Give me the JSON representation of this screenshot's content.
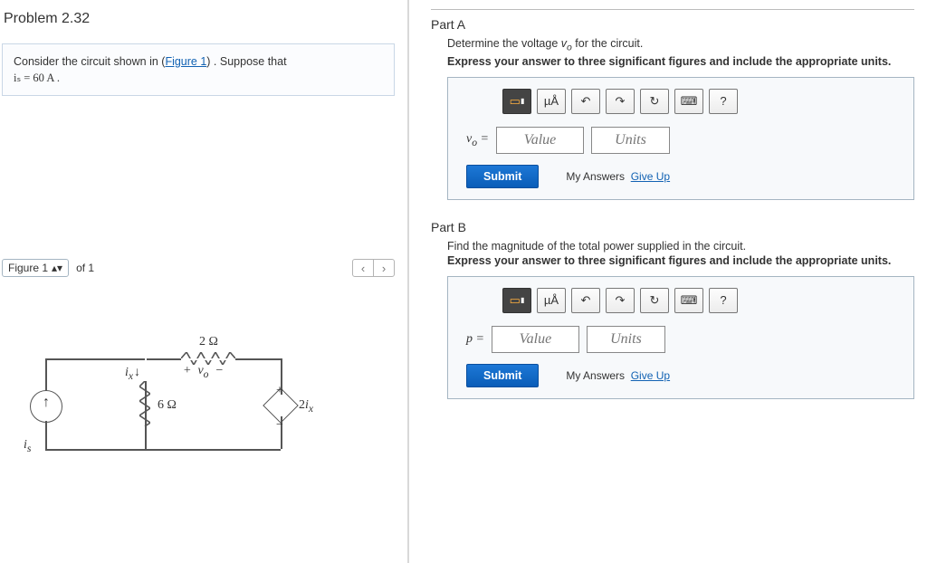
{
  "problem": {
    "number": "Problem 2.32",
    "text_before": "Consider the circuit shown in (",
    "fig_link": "Figure 1",
    "text_after": ") . Suppose that",
    "given": "iₛ = 60   A ."
  },
  "figure": {
    "selector": "Figure 1",
    "count": "of 1",
    "labels": {
      "r_top": "2 Ω",
      "r_mid": "6 Ω",
      "vo": "+   v_o   −",
      "ix": "i_x",
      "is": "i_s",
      "dep": "2i_x"
    }
  },
  "partA": {
    "title": "Part A",
    "prompt": "Determine the voltage v_o for the circuit.",
    "rule": "Express your answer to three significant figures and include the appropriate units.",
    "var": "v_o =",
    "value_ph": "Value",
    "units_ph": "Units",
    "submit": "Submit",
    "my_answers": "My Answers",
    "giveup": "Give Up"
  },
  "partB": {
    "title": "Part B",
    "prompt": "Find the magnitude of the total power supplied in the circuit.",
    "rule": "Express your answer to three significant figures and include the appropriate units.",
    "var": "p =",
    "value_ph": "Value",
    "units_ph": "Units",
    "submit": "Submit",
    "my_answers": "My Answers",
    "giveup": "Give Up"
  },
  "toolbar": {
    "units": "µÅ",
    "help": "?"
  }
}
